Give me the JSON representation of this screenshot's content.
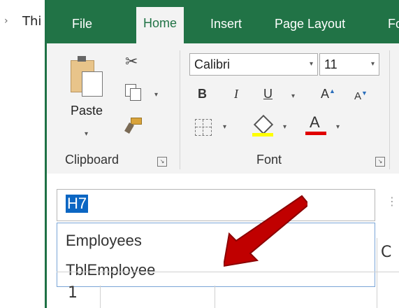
{
  "background": {
    "chevron": "›",
    "text": "Thi"
  },
  "tabs": [
    "File",
    "Home",
    "Insert",
    "Page Layout",
    "Fo"
  ],
  "active_tab": "Home",
  "clipboard": {
    "paste_label": "Paste",
    "group_label": "Clipboard"
  },
  "font": {
    "name": "Calibri",
    "size": "11",
    "group_label": "Font",
    "bold": "B",
    "italic": "I",
    "underline": "U",
    "grow": "A",
    "shrink": "A",
    "color": "A"
  },
  "namebox": {
    "value": "H7"
  },
  "dropdown": {
    "items": [
      "Employees",
      "TblEmployee"
    ]
  },
  "grid": {
    "column": "C",
    "row": "1"
  },
  "colors": {
    "excel_green": "#217346",
    "selection_blue": "#0b66c3",
    "arrow_red": "#c00000"
  }
}
